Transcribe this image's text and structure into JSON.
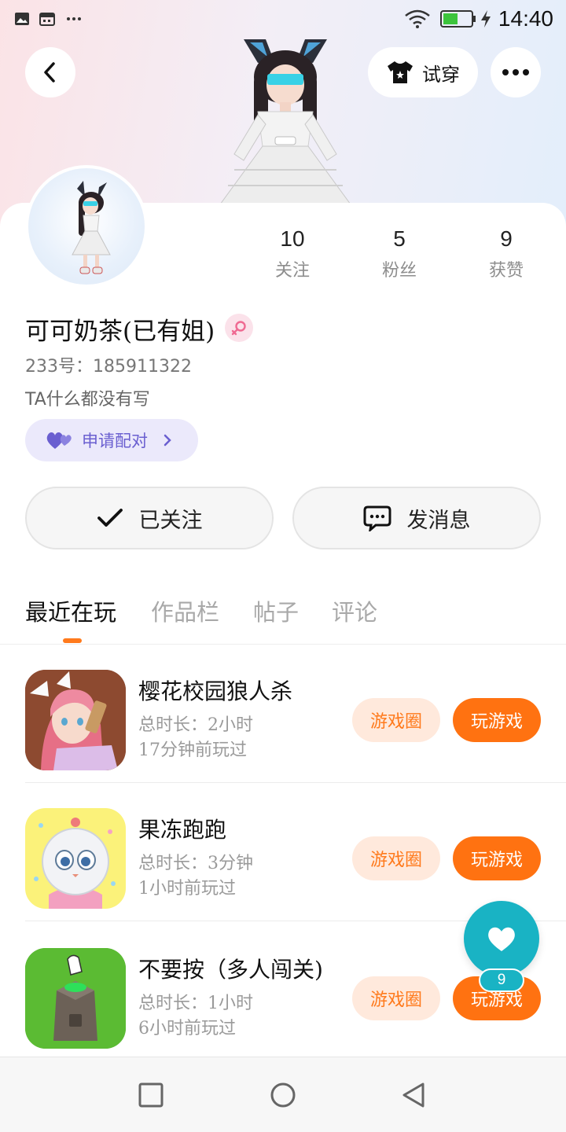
{
  "status_bar": {
    "time": "14:40",
    "icons": [
      "image-icon",
      "calendar-icon",
      "more-dots-icon",
      "wifi-icon",
      "battery-icon",
      "charging-icon"
    ],
    "battery_color": "#3cc43c"
  },
  "header": {
    "try_on_label": "试穿",
    "icons": [
      "back-icon",
      "tshirt-icon",
      "more-icon"
    ]
  },
  "profile": {
    "stats": [
      {
        "value": "10",
        "label": "关注"
      },
      {
        "value": "5",
        "label": "粉丝"
      },
      {
        "value": "9",
        "label": "获赞"
      }
    ],
    "username": "可可奶茶(已有姐)",
    "gender": "female",
    "user_id": "233号：185911322",
    "bio": "TA什么都没有写",
    "pair_button_label": "申请配对",
    "follow_button_label": "已关注",
    "message_button_label": "发消息"
  },
  "tabs": [
    {
      "label": "最近在玩",
      "active": true
    },
    {
      "label": "作品栏",
      "active": false
    },
    {
      "label": "帖子",
      "active": false
    },
    {
      "label": "评论",
      "active": false
    }
  ],
  "games": [
    {
      "title": "樱花校园狼人杀",
      "duration": "总时长：2小时",
      "last_played": "17分钟前玩过",
      "circle_label": "游戏圈",
      "play_label": "玩游戏"
    },
    {
      "title": "果冻跑跑",
      "duration": "总时长：3分钟",
      "last_played": "1小时前玩过",
      "circle_label": "游戏圈",
      "play_label": "玩游戏"
    },
    {
      "title": "不要按（多人闯关)",
      "duration": "总时长：1小时",
      "last_played": "6小时前玩过",
      "circle_label": "游戏圈",
      "play_label": "玩游戏"
    }
  ],
  "like_fab": {
    "count": "9"
  },
  "colors": {
    "accent_orange": "#ff7211",
    "teal": "#19b3c4",
    "pair_purple": "#6a5fd0"
  }
}
